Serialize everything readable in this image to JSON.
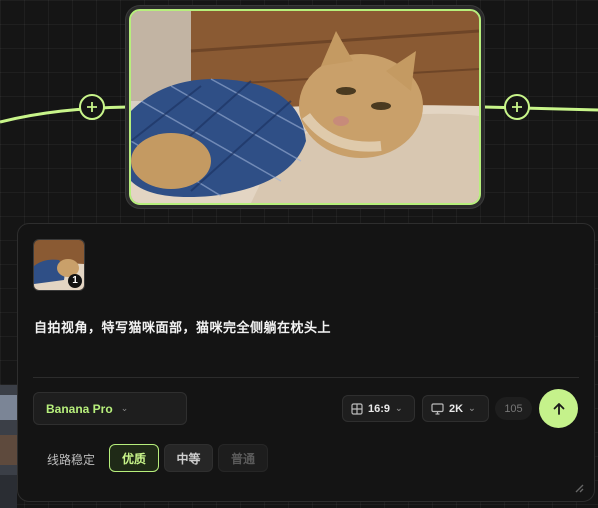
{
  "canvas": {
    "wire_color": "#c8f58a"
  },
  "image_node": {
    "alt": "cat lying on side on pillow wearing blue plaid shirt"
  },
  "panel": {
    "reference": {
      "badge": "1"
    },
    "prompt": "自拍视角，特写猫咪面部，猫咪完全侧躺在枕头上",
    "model": {
      "label": "Banana Pro"
    },
    "aspect": {
      "label": "16:9",
      "icon": "grid-icon"
    },
    "resolution": {
      "label": "2K",
      "icon": "monitor-icon"
    },
    "count": "105",
    "send_icon": "arrow-up-icon",
    "route": {
      "label": "线路稳定",
      "options": [
        {
          "label": "优质",
          "state": "selected"
        },
        {
          "label": "中等",
          "state": "normal"
        },
        {
          "label": "普通",
          "state": "disabled"
        }
      ]
    }
  },
  "colors": {
    "accent": "#c5f28b",
    "panel_bg": "#141414",
    "canvas_bg": "#151515"
  }
}
